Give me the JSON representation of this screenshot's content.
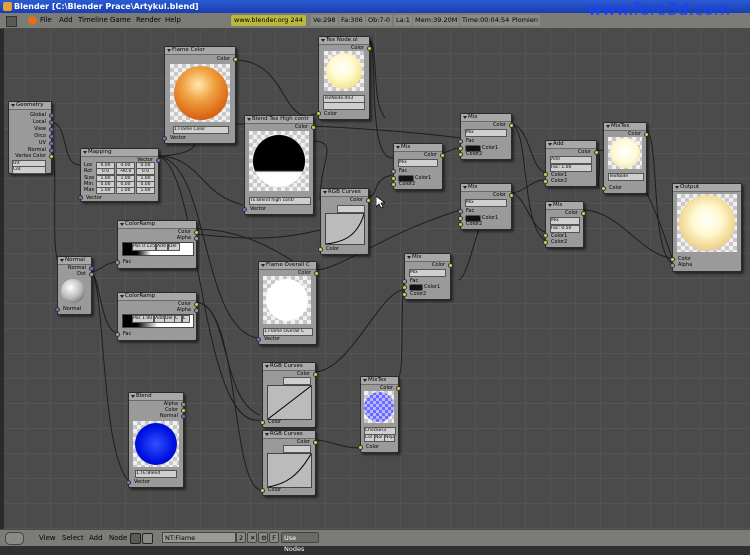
{
  "window": {
    "title": "Blender [C:\\Blender Prace\\Artykul.blend]"
  },
  "watermark": "www.foro3d.com",
  "menu": {
    "items": [
      "File",
      "Add",
      "Timeline",
      "Game",
      "Render",
      "Help"
    ],
    "url": "www.blender.org 244",
    "stats": [
      "Ve:298",
      "Fa:306",
      "Ob:7-0",
      "La:1",
      "Mem:39.20M",
      "Time:00:04:54",
      "Plomien"
    ]
  },
  "nodes": {
    "geometry": {
      "title": "Geometry",
      "outputs": [
        "Global",
        "Local",
        "View",
        "Orco",
        "UV",
        "Normal",
        "Vertex Color"
      ],
      "uv_field": "UV:",
      "col_field": "Col:"
    },
    "mapping": {
      "title": "Mapping",
      "rows": [
        {
          "label": "Loc",
          "v": [
            "0.00",
            "0.00",
            "0.00"
          ]
        },
        {
          "label": "Rot",
          "v": [
            "0.0",
            "-90.0",
            "0.0"
          ]
        },
        {
          "label": "Size",
          "v": [
            "1.00",
            "1.00",
            "1.00"
          ]
        },
        {
          "label": "Min",
          "v": [
            "0.00",
            "0.00",
            "0.00"
          ]
        },
        {
          "label": "Max",
          "v": [
            "1.00",
            "1.00",
            "1.00"
          ]
        }
      ],
      "in": "Vector",
      "out": "Vector"
    },
    "flame_color": {
      "title": "Flame Color",
      "out": "Color",
      "field": "1.Flame Color",
      "in": "Vector"
    },
    "tex_mode": {
      "title": "Tex Node.ol",
      "field": "TexNode.003",
      "out": "Color",
      "in": "Color"
    },
    "blend_high": {
      "title": "Blend Tex High contr",
      "field": "TE:Blend high contr",
      "out": "Color",
      "in": "Vector"
    },
    "rgb_curves1": {
      "title": "RGB Curves",
      "out": "Color",
      "in": "Color",
      "btns": [
        "C",
        "R",
        "G",
        "B"
      ]
    },
    "colorramp1": {
      "title": "ColorRamp",
      "out_color": "Color",
      "out_alpha": "Alpha",
      "in": "Fac",
      "field": "Add",
      "pos": "0",
      "pos_label": "Pos 0.125",
      "tags": [
        "Add",
        "Del"
      ]
    },
    "normal": {
      "title": "Normal",
      "out_normal": "Normal",
      "out_dot": "Dot",
      "in": "Normal"
    },
    "colorramp2": {
      "title": "ColorRamp",
      "out_color": "Color",
      "out_alpha": "Alpha",
      "in": "Fac",
      "pos_label": "Pos 1.00",
      "tags": [
        "Add",
        "Del",
        "C",
        "L"
      ]
    },
    "flame_overall": {
      "title": "Flame Overall C",
      "out": "Color",
      "field": "1.Flame Overall C",
      "in": "Vector"
    },
    "blend": {
      "title": "Blend",
      "outs": [
        "Color",
        "Normal"
      ],
      "out_alpha": "Alpha",
      "field": "1.TE:Blend",
      "in": "Vector"
    },
    "mix1": {
      "title": "Mix",
      "field": "Mix",
      "in_fac": "Fac",
      "in_c1": "Color1",
      "in_c2": "Color2",
      "out": "Color"
    },
    "mix2": {
      "title": "Mix",
      "field": "Mix",
      "in_fac": "Fac",
      "in_c1": "Color1",
      "in_c2": "Color2",
      "out": "Color"
    },
    "mix3": {
      "title": "Mix",
      "field": "Mix",
      "in_fac": "Fac",
      "in_c1": "Color1",
      "in_c2": "Color2",
      "out": "Color"
    },
    "mix4": {
      "title": "Mix",
      "field": "Mix",
      "in_fac": "Fac",
      "in_c1": "Color1",
      "in_c2": "Color2",
      "out": "Color"
    },
    "add": {
      "title": "Add",
      "field": "Add",
      "fac": "Fac: 1.00",
      "in_c1": "Color1",
      "in_c2": "Color2",
      "out": "Color"
    },
    "mix5": {
      "title": "Mix",
      "field": "Mix",
      "fac": "Fac: 0.50",
      "in_c1": "Color1",
      "in_c2": "Color2",
      "out": "Color"
    },
    "mixtex": {
      "title": "MixTex",
      "field": "TexNode",
      "out": "Color",
      "in": "Color"
    },
    "output": {
      "title": "Output",
      "in_color": "Color",
      "in_alpha": "Alpha"
    },
    "rgb_curves2": {
      "title": "RGB Curves",
      "out": "Color",
      "in": "Color",
      "btns": [
        "C",
        "R",
        "G",
        "B"
      ]
    },
    "rgb_curves3": {
      "title": "RGB Curves",
      "out": "Color",
      "in": "Color",
      "btns": [
        "C",
        "R",
        "G",
        "B"
      ]
    },
    "mixtex2": {
      "title": "MixTex",
      "field": "Checker3",
      "out": "Color",
      "in": "Color",
      "btns": [
        "Col",
        "Nor",
        "Nep"
      ]
    }
  },
  "statusbar": {
    "items": [
      "View",
      "Select",
      "Add",
      "Node"
    ],
    "nt_field": "NT:Flame",
    "users": "2",
    "f_label": "F",
    "use_nodes": "Use Nodes"
  }
}
